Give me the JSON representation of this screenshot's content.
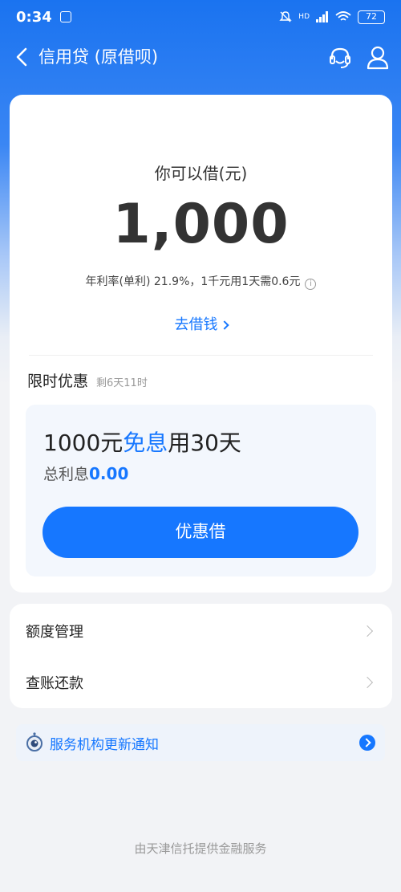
{
  "status_bar": {
    "time": "0:34",
    "network": "HD",
    "battery": "72"
  },
  "header": {
    "title": "信用贷 (原借呗)"
  },
  "loan": {
    "borrow_label": "你可以借(元)",
    "amount": "1,000",
    "rate_text": "年利率(单利) 21.9%，1千元用1天需0.6元",
    "borrow_link": "去借钱"
  },
  "promo": {
    "title": "限时优惠",
    "remaining": "剩6天11时",
    "headline_pre": "1000元",
    "headline_hl": "免息",
    "headline_post": "用30天",
    "interest_label": "总利息",
    "interest_value": "0.00",
    "button_label": "优惠借"
  },
  "menu": {
    "items": [
      {
        "label": "额度管理"
      },
      {
        "label": "查账还款"
      }
    ]
  },
  "notice": {
    "text": "服务机构更新通知"
  },
  "footer": {
    "text": "由天津信托提供金融服务"
  },
  "colors": {
    "accent": "#1677ff",
    "header_bg": "#1a73f0"
  }
}
